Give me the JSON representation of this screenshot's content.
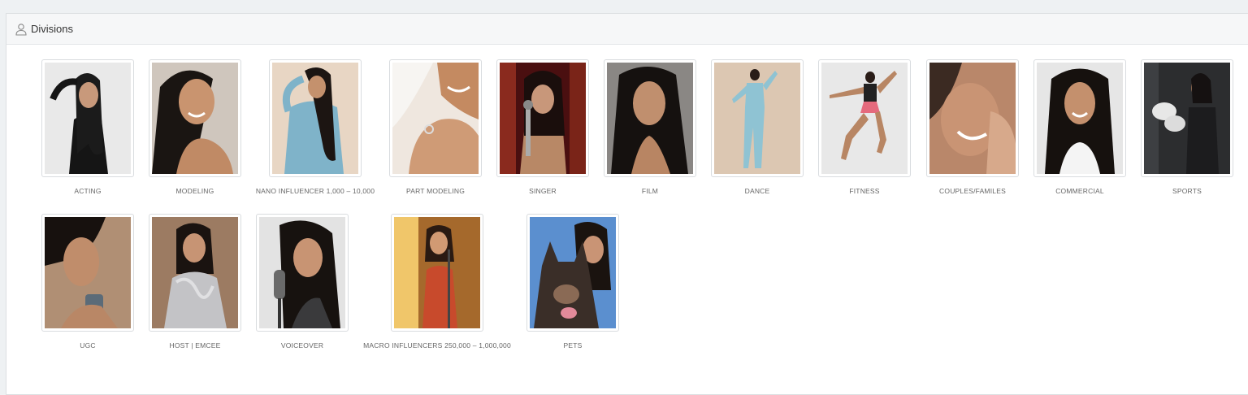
{
  "header": {
    "title": "Divisions",
    "icon": "user-icon"
  },
  "divisions": [
    {
      "label": "ACTING",
      "thumb": "photo-acting"
    },
    {
      "label": "MODELING",
      "thumb": "photo-modeling"
    },
    {
      "label": "NANO INFLUENCER 1,000 – 10,000",
      "thumb": "photo-nano-influencer"
    },
    {
      "label": "PART MODELING",
      "thumb": "photo-part-modeling"
    },
    {
      "label": "SINGER",
      "thumb": "photo-singer"
    },
    {
      "label": "FILM",
      "thumb": "photo-film"
    },
    {
      "label": "DANCE",
      "thumb": "photo-dance"
    },
    {
      "label": "FITNESS",
      "thumb": "photo-fitness"
    },
    {
      "label": "COUPLES/FAMILES",
      "thumb": "photo-couples"
    },
    {
      "label": "COMMERCIAL",
      "thumb": "photo-commercial"
    },
    {
      "label": "SPORTS",
      "thumb": "photo-sports"
    },
    {
      "label": "UGC",
      "thumb": "photo-ugc"
    },
    {
      "label": "HOST | EMCEE",
      "thumb": "photo-host"
    },
    {
      "label": "VOICEOVER",
      "thumb": "photo-voiceover"
    },
    {
      "label": "MACRO INFLUENCERS 250,000 – 1,000,000",
      "thumb": "photo-macro-influencers"
    },
    {
      "label": "PETS",
      "thumb": "photo-pets"
    }
  ]
}
